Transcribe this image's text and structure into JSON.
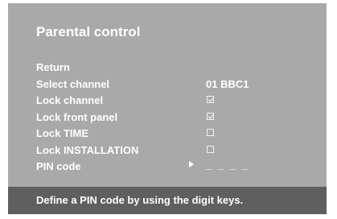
{
  "title": "Parental control",
  "menu": {
    "return_label": "Return",
    "select_channel_label": "Select channel",
    "select_channel_value": "01 BBC1",
    "lock_channel_label": "Lock channel",
    "lock_channel_checked": true,
    "lock_front_panel_label": "Lock front panel",
    "lock_front_panel_checked": true,
    "lock_time_label": "Lock TIME",
    "lock_time_checked": false,
    "lock_installation_label": "Lock INSTALLATION",
    "lock_installation_checked": false,
    "pin_code_label": "PIN code",
    "pin_code_value": "_ _ _ _"
  },
  "footer": {
    "hint": "Define a PIN code by using the digit keys."
  },
  "icons": {
    "checkbox": "checkbox-icon",
    "selection_arrow": "play-arrow-icon"
  },
  "colors": {
    "panel": "#a9a9a9",
    "footer": "#5f5f5f",
    "text": "#ffffff"
  }
}
